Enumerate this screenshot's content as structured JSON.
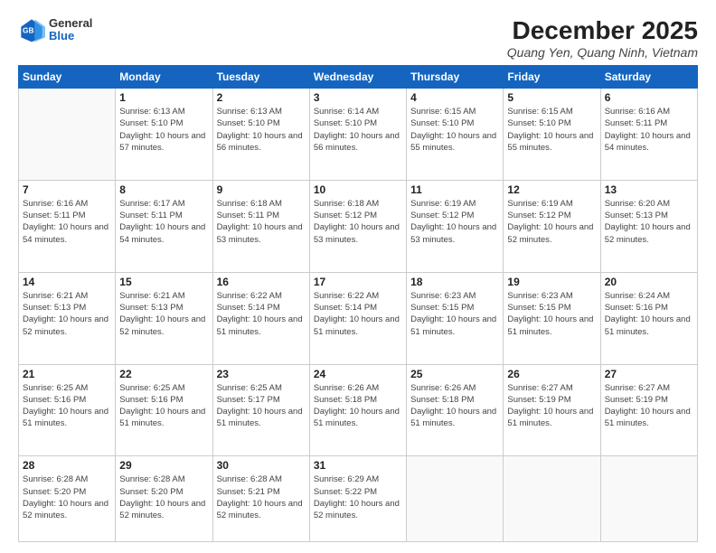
{
  "header": {
    "logo": {
      "general": "General",
      "blue": "Blue"
    },
    "title": "December 2025",
    "location": "Quang Yen, Quang Ninh, Vietnam"
  },
  "days_of_week": [
    "Sunday",
    "Monday",
    "Tuesday",
    "Wednesday",
    "Thursday",
    "Friday",
    "Saturday"
  ],
  "weeks": [
    [
      {
        "day": "",
        "info": ""
      },
      {
        "day": "1",
        "info": "Sunrise: 6:13 AM\nSunset: 5:10 PM\nDaylight: 10 hours\nand 57 minutes."
      },
      {
        "day": "2",
        "info": "Sunrise: 6:13 AM\nSunset: 5:10 PM\nDaylight: 10 hours\nand 56 minutes."
      },
      {
        "day": "3",
        "info": "Sunrise: 6:14 AM\nSunset: 5:10 PM\nDaylight: 10 hours\nand 56 minutes."
      },
      {
        "day": "4",
        "info": "Sunrise: 6:15 AM\nSunset: 5:10 PM\nDaylight: 10 hours\nand 55 minutes."
      },
      {
        "day": "5",
        "info": "Sunrise: 6:15 AM\nSunset: 5:10 PM\nDaylight: 10 hours\nand 55 minutes."
      },
      {
        "day": "6",
        "info": "Sunrise: 6:16 AM\nSunset: 5:11 PM\nDaylight: 10 hours\nand 54 minutes."
      }
    ],
    [
      {
        "day": "7",
        "info": "Sunrise: 6:16 AM\nSunset: 5:11 PM\nDaylight: 10 hours\nand 54 minutes."
      },
      {
        "day": "8",
        "info": "Sunrise: 6:17 AM\nSunset: 5:11 PM\nDaylight: 10 hours\nand 54 minutes."
      },
      {
        "day": "9",
        "info": "Sunrise: 6:18 AM\nSunset: 5:11 PM\nDaylight: 10 hours\nand 53 minutes."
      },
      {
        "day": "10",
        "info": "Sunrise: 6:18 AM\nSunset: 5:12 PM\nDaylight: 10 hours\nand 53 minutes."
      },
      {
        "day": "11",
        "info": "Sunrise: 6:19 AM\nSunset: 5:12 PM\nDaylight: 10 hours\nand 53 minutes."
      },
      {
        "day": "12",
        "info": "Sunrise: 6:19 AM\nSunset: 5:12 PM\nDaylight: 10 hours\nand 52 minutes."
      },
      {
        "day": "13",
        "info": "Sunrise: 6:20 AM\nSunset: 5:13 PM\nDaylight: 10 hours\nand 52 minutes."
      }
    ],
    [
      {
        "day": "14",
        "info": "Sunrise: 6:21 AM\nSunset: 5:13 PM\nDaylight: 10 hours\nand 52 minutes."
      },
      {
        "day": "15",
        "info": "Sunrise: 6:21 AM\nSunset: 5:13 PM\nDaylight: 10 hours\nand 52 minutes."
      },
      {
        "day": "16",
        "info": "Sunrise: 6:22 AM\nSunset: 5:14 PM\nDaylight: 10 hours\nand 51 minutes."
      },
      {
        "day": "17",
        "info": "Sunrise: 6:22 AM\nSunset: 5:14 PM\nDaylight: 10 hours\nand 51 minutes."
      },
      {
        "day": "18",
        "info": "Sunrise: 6:23 AM\nSunset: 5:15 PM\nDaylight: 10 hours\nand 51 minutes."
      },
      {
        "day": "19",
        "info": "Sunrise: 6:23 AM\nSunset: 5:15 PM\nDaylight: 10 hours\nand 51 minutes."
      },
      {
        "day": "20",
        "info": "Sunrise: 6:24 AM\nSunset: 5:16 PM\nDaylight: 10 hours\nand 51 minutes."
      }
    ],
    [
      {
        "day": "21",
        "info": "Sunrise: 6:25 AM\nSunset: 5:16 PM\nDaylight: 10 hours\nand 51 minutes."
      },
      {
        "day": "22",
        "info": "Sunrise: 6:25 AM\nSunset: 5:16 PM\nDaylight: 10 hours\nand 51 minutes."
      },
      {
        "day": "23",
        "info": "Sunrise: 6:25 AM\nSunset: 5:17 PM\nDaylight: 10 hours\nand 51 minutes."
      },
      {
        "day": "24",
        "info": "Sunrise: 6:26 AM\nSunset: 5:18 PM\nDaylight: 10 hours\nand 51 minutes."
      },
      {
        "day": "25",
        "info": "Sunrise: 6:26 AM\nSunset: 5:18 PM\nDaylight: 10 hours\nand 51 minutes."
      },
      {
        "day": "26",
        "info": "Sunrise: 6:27 AM\nSunset: 5:19 PM\nDaylight: 10 hours\nand 51 minutes."
      },
      {
        "day": "27",
        "info": "Sunrise: 6:27 AM\nSunset: 5:19 PM\nDaylight: 10 hours\nand 51 minutes."
      }
    ],
    [
      {
        "day": "28",
        "info": "Sunrise: 6:28 AM\nSunset: 5:20 PM\nDaylight: 10 hours\nand 52 minutes."
      },
      {
        "day": "29",
        "info": "Sunrise: 6:28 AM\nSunset: 5:20 PM\nDaylight: 10 hours\nand 52 minutes."
      },
      {
        "day": "30",
        "info": "Sunrise: 6:28 AM\nSunset: 5:21 PM\nDaylight: 10 hours\nand 52 minutes."
      },
      {
        "day": "31",
        "info": "Sunrise: 6:29 AM\nSunset: 5:22 PM\nDaylight: 10 hours\nand 52 minutes."
      },
      {
        "day": "",
        "info": ""
      },
      {
        "day": "",
        "info": ""
      },
      {
        "day": "",
        "info": ""
      }
    ]
  ]
}
